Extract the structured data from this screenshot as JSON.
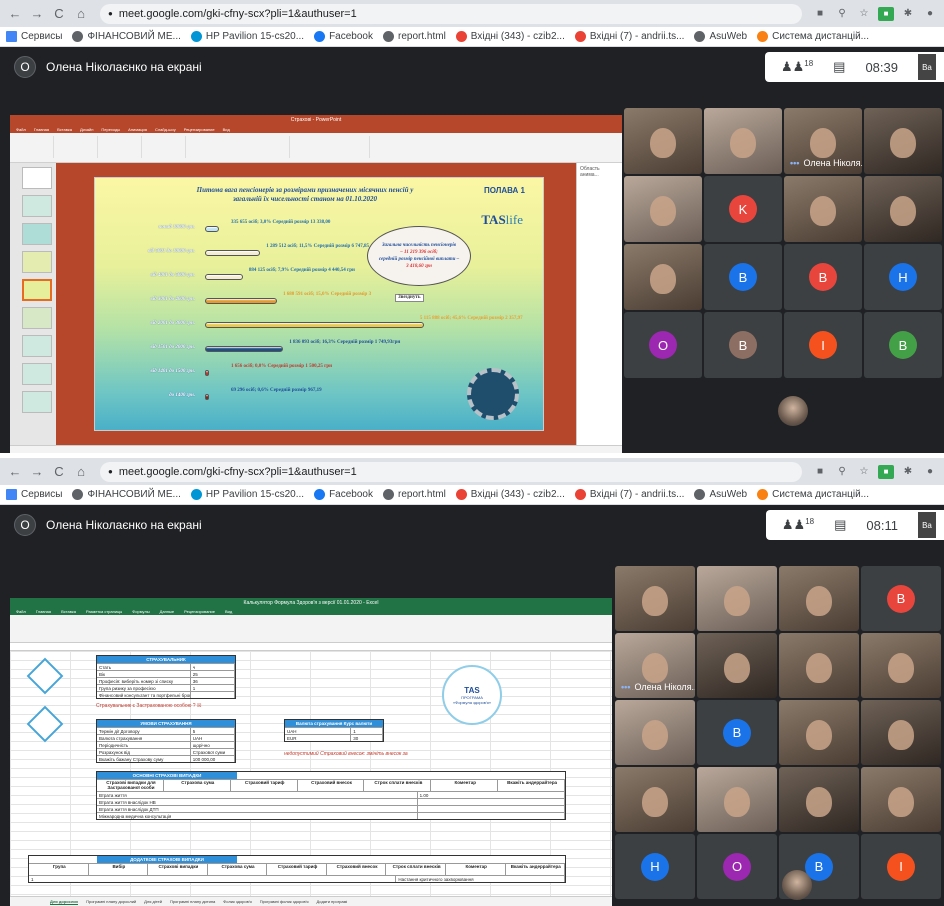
{
  "colors": {
    "meet_bg": "#202124",
    "chrome_bg": "#dee1e6",
    "accent_blue": "#1a73e8",
    "excel_green": "#217346",
    "ppt_orange": "#b7472a"
  },
  "browser": {
    "nav_back": "←",
    "nav_forward": "→",
    "reload": "C",
    "home": "⌂",
    "lock": "🔒",
    "bookmarks": [
      "Сервисы",
      "ФІНАНСОВИЙ МЕ...",
      "HP Pavilion 15-cs20...",
      "Facebook",
      "report.html",
      "Вхідні (343) - czib2...",
      "Вхідні (7) - andrii.ts...",
      "AsuWeb",
      "Система дистанцій..."
    ]
  },
  "shot1": {
    "url": "meet.google.com/gki-cfny-scx?pli=1&authuser=1",
    "presenter_initial": "О",
    "presenting_text": "Олена Ніколаєнко на екрані",
    "participants": "18",
    "time": "08:39",
    "me_label": "Ва",
    "ppt": {
      "window_title": "Страхові - PowerPoint",
      "slide_title": "Питома вага пенсіонерів за розмірами призначених місячних пенсій у загальній їх чисельності станом на 01.10.2020",
      "badge": "ПОЛАВА 1",
      "logo": "TAS",
      "logo_suffix": "life",
      "side_panel_title": "Область анима...",
      "callout": [
        "Загальна чисельність пенсіонерів",
        "– 11 219 396 осіб;",
        "середній розмір пенсійної виплати –",
        "3 418,60 грн"
      ],
      "tooltip": "Звезднуть"
    },
    "tiles": [
      {
        "type": "photo"
      },
      {
        "type": "photo2"
      },
      {
        "type": "photo",
        "label": "Олена Ніколя..."
      },
      {
        "type": "photo3"
      },
      {
        "type": "photo2"
      },
      {
        "type": "avatar",
        "letter": "K",
        "color": "#e8453c"
      },
      {
        "type": "photo"
      },
      {
        "type": "photo3"
      },
      {
        "type": "photo"
      },
      {
        "type": "avatar",
        "letter": "B",
        "color": "#1a73e8"
      },
      {
        "type": "avatar",
        "letter": "B",
        "color": "#e8453c"
      },
      {
        "type": "avatar",
        "letter": "H",
        "color": "#1a73e8"
      },
      {
        "type": "avatar",
        "letter": "O",
        "color": "#9c27b0"
      },
      {
        "type": "avatar",
        "letter": "B",
        "color": "#8d6e63"
      },
      {
        "type": "avatar",
        "letter": "I",
        "color": "#f4511e"
      },
      {
        "type": "avatar",
        "letter": "B",
        "color": "#43a047"
      }
    ]
  },
  "shot2": {
    "url": "meet.google.com/gki-cfny-scx?pli=1&authuser=1",
    "presenter_initial": "О",
    "presenting_text": "Олена Ніколаєнко на екрані",
    "participants": "18",
    "time": "08:11",
    "me_label": "Ва",
    "excel": {
      "window_title": "Калькулятор Формула Здоров'я з версії 01.01.2020 - Excel",
      "sheets": [
        "Для дорослих",
        "Програмні плану дорослий",
        "Для дітей",
        "Програмні плану дитина",
        "Фолик здоров'я",
        "Програмні фолик здоров'я",
        "Додати програмі"
      ],
      "box1": {
        "header": "СТРАХУВАЛЬНИК",
        "rows": [
          [
            "Стать",
            "ч"
          ],
          [
            "Вік",
            "25"
          ],
          [
            "Професія: виберіть номер зі списку",
            "36"
          ],
          [
            "Група ризику за професією",
            "1"
          ],
          [
            "Фінансовий консультант та портфельні брокери",
            ""
          ]
        ]
      },
      "note1": "Страхувальник є Застрахованою особою ?",
      "note1_mark": "☒",
      "box2": {
        "header": "УМОВИ СТРАХУВАННЯ",
        "rows": [
          [
            "Термін дії Договору",
            "5"
          ],
          [
            "Валюта страхування",
            "UAH"
          ],
          [
            "Періодичність",
            "щорічно"
          ],
          [
            "Розрахунок від",
            "Страхової суми"
          ],
          [
            "Вкажіть бажану Страхову суму",
            "100 000,00"
          ]
        ]
      },
      "box3": {
        "header": "Валюта страхування Курс валюти",
        "rows": [
          [
            "UAH",
            "1"
          ],
          [
            "EUR",
            "30"
          ]
        ]
      },
      "note2": "недопустимий Страховий внесок: змініть внесок за",
      "box4": {
        "header": "ОСНОВНІ СТРАХОВІ ВИПАДКИ",
        "cols": [
          "Страхові випадки для Застрахованої особи",
          "Страхова сума",
          "Страховий тариф",
          "Страховий внесок",
          "Строк сплати внесків",
          "Коментар",
          "Вкажіть андеррайтера"
        ],
        "rows": [
          [
            "Втрата життя",
            "1.00"
          ],
          [
            "Втрата життя внаслідок НВ",
            ""
          ],
          [
            "Втрата життя внаслідок ДТП",
            ""
          ],
          [
            "Міжнародна медична консультація",
            ""
          ]
        ]
      },
      "box5": {
        "header": "ДОДАТКОВІ СТРАХОВІ ВИПАДКИ",
        "cols": [
          "Група",
          "Вибір",
          "Страхові випадки",
          "Страхова сума",
          "Страховий тариф",
          "Страховий внесок",
          "Строк сплати внесків",
          "Коментар",
          "Вкажіть андеррайтера"
        ],
        "rows": [
          [
            "1",
            "Настання критичного захворювання"
          ]
        ]
      },
      "tas": {
        "logo": "TAS",
        "line1": "ПРОГРАМА",
        "line2": "«Формула здоров'я»"
      }
    },
    "tiles": [
      {
        "type": "photo"
      },
      {
        "type": "photo2"
      },
      {
        "type": "photo"
      },
      {
        "type": "avatar",
        "letter": "B",
        "color": "#e8453c"
      },
      {
        "type": "photo2",
        "label": "Олена Ніколя..."
      },
      {
        "type": "photo3"
      },
      {
        "type": "photo"
      },
      {
        "type": "photo"
      },
      {
        "type": "photo2"
      },
      {
        "type": "avatar",
        "letter": "B",
        "color": "#1a73e8"
      },
      {
        "type": "photo"
      },
      {
        "type": "photo3"
      },
      {
        "type": "photo"
      },
      {
        "type": "photo2"
      },
      {
        "type": "photo3"
      },
      {
        "type": "photo"
      },
      {
        "type": "avatar",
        "letter": "H",
        "color": "#1a73e8"
      },
      {
        "type": "avatar",
        "letter": "O",
        "color": "#9c27b0"
      },
      {
        "type": "avatar",
        "letter": "B",
        "color": "#1a73e8"
      },
      {
        "type": "avatar",
        "letter": "I",
        "color": "#f4511e"
      }
    ]
  },
  "chart_data": {
    "type": "bar",
    "title": "Питома вага пенсіонерів за розмірами призначених місячних пенсій у загальній їх чисельності станом на 01.10.2020",
    "categories": [
      "понад 10000 грн.",
      "від 5001 до 10000 грн.",
      "від 4001 до 5000 грн.",
      "від 3001 до 4000 грн.",
      "від 2001 до 3000 грн.",
      "від 1501 до 2000 грн.",
      "від 1401 до 1500 грн.",
      "до 1400 грн."
    ],
    "values": [
      3.0,
      11.5,
      7.9,
      15.0,
      45.6,
      16.3,
      0.0,
      0.6
    ],
    "labels": [
      "335 655 осіб; 3,0% Середній розмір 13 338,00",
      "1 289 512 осіб; 11,5% Середній розмір 6 747,85",
      "884 125 осіб; 7,9% Середній розмір 4 440,54 грн",
      "1 680 591 осіб; 15,0% Середній розмір 3",
      "5 115 888 осіб; 45,6% Середній розмір 2 357,97",
      "1 836 093 осіб; 16,3% Середній розмір 1 749,93грн",
      "1 656 осіб; 0,0% Середній розмір 1 500,25 грн",
      "69 296 осіб; 0,6% Середній розмір 967,19"
    ],
    "colors": [
      "#bfe3f0",
      "#f3ecd0",
      "#f3ecd0",
      "#e39a2e",
      "#e8c84a",
      "#1e4f82",
      "#c0392b",
      "#7a2a1e"
    ],
    "label_colors": [
      "#1f6fb0",
      "#1f6fb0",
      "#1f6fb0",
      "#e39a2e",
      "#e8a030",
      "#1f4e9b",
      "#c0392b",
      "#1f4e9b"
    ],
    "ylim": [
      0,
      50
    ]
  }
}
